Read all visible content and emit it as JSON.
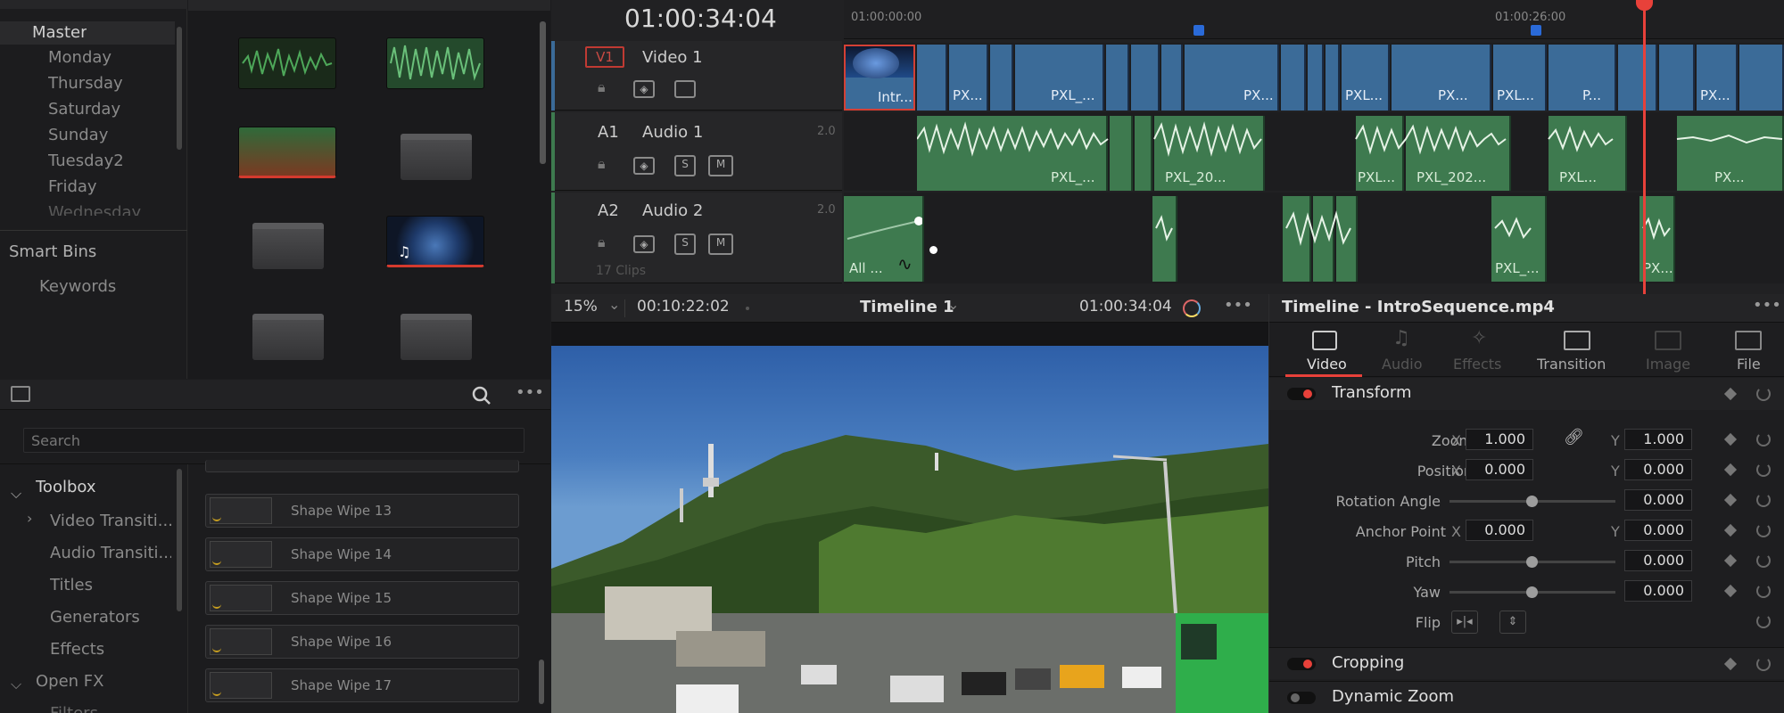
{
  "media_pool": {
    "bins": [
      "Master",
      "Monday",
      "Thursday",
      "Saturday",
      "Sunday",
      "Tuesday2",
      "Friday",
      "Wednesday"
    ],
    "smart_bins_label": "Smart Bins",
    "keywords_label": "Keywords"
  },
  "timecode_main": "01:00:34:04",
  "timeline": {
    "ruler": [
      "01:00:00:00",
      "01:00:26:00"
    ],
    "v1": {
      "id": "V1",
      "name": "Video 1"
    },
    "a1": {
      "id": "A1",
      "name": "Audio 1",
      "level": "2.0"
    },
    "a2": {
      "id": "A2",
      "name": "Audio 2",
      "level": "2.0",
      "clips_count": "17 Clips"
    },
    "vclips": [
      "Intr...",
      "PX...",
      "PXL_...",
      "PX...",
      "PXL...",
      "PX...",
      "PXL...",
      "P...",
      "PX..."
    ],
    "aclips": [
      "PXL_...",
      "PXL_20...",
      "PXL...",
      "PXL_202...",
      "PXL...",
      "PX..."
    ],
    "a2clips": [
      "All ...",
      "PXL_...",
      "PX..."
    ]
  },
  "viewer_bar": {
    "zoom": "15%",
    "duration": "00:10:22:02",
    "timeline_name": "Timeline 1",
    "timecode": "01:00:34:04"
  },
  "effects": {
    "search_placeholder": "Search",
    "tree": [
      "Toolbox",
      "Video Transiti...",
      "Audio Transiti...",
      "Titles",
      "Generators",
      "Effects",
      "Open FX",
      "Filters"
    ],
    "items": [
      "Shape Wipe 13",
      "Shape Wipe 14",
      "Shape Wipe 15",
      "Shape Wipe 16",
      "Shape Wipe 17"
    ]
  },
  "inspector": {
    "title": "Timeline - IntroSequence.mp4",
    "tabs": [
      "Video",
      "Audio",
      "Effects",
      "Transition",
      "Image",
      "File"
    ],
    "transform_label": "Transform",
    "zoom_label": "Zoom",
    "zoom_x": "1.000",
    "zoom_y": "1.000",
    "position_label": "Position",
    "position_x": "0.000",
    "position_y": "0.000",
    "rotation_label": "Rotation Angle",
    "rotation": "0.000",
    "anchor_label": "Anchor Point",
    "anchor_x": "0.000",
    "anchor_y": "0.000",
    "pitch_label": "Pitch",
    "pitch": "0.000",
    "yaw_label": "Yaw",
    "yaw": "0.000",
    "flip_label": "Flip",
    "x": "X",
    "y": "Y",
    "cropping_label": "Cropping",
    "dynamic_zoom_label": "Dynamic Zoom"
  },
  "colors": {
    "accent": "#e8413a",
    "video_clip": "#3b6b98",
    "audio_clip": "#3e7a4f",
    "playhead": "#e8413a"
  }
}
